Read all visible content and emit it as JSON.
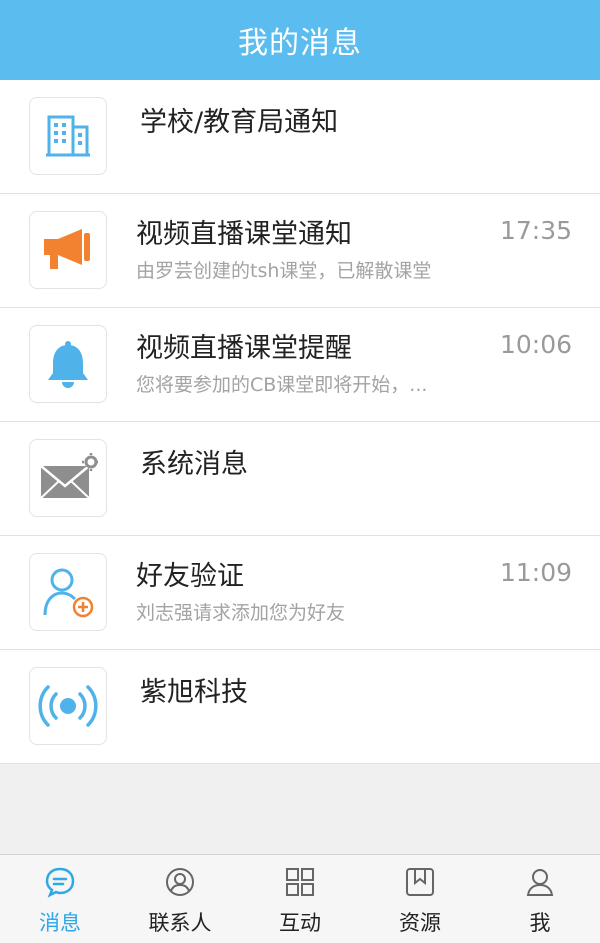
{
  "header": {
    "title": "我的消息"
  },
  "messages": [
    {
      "title": "学校/教育局通知",
      "subtitle": "",
      "time": "",
      "icon": "building-icon"
    },
    {
      "title": "视频直播课堂通知",
      "subtitle": "由罗芸创建的tsh课堂，已解散课堂",
      "time": "17:35",
      "icon": "megaphone-icon"
    },
    {
      "title": "视频直播课堂提醒",
      "subtitle": "您将要参加的CB课堂即将开始，...",
      "time": "10:06",
      "icon": "bell-icon"
    },
    {
      "title": "系统消息",
      "subtitle": "",
      "time": "",
      "icon": "mail-gear-icon"
    },
    {
      "title": "好友验证",
      "subtitle": "刘志强请求添加您为好友",
      "time": "11:09",
      "icon": "add-friend-icon"
    },
    {
      "title": "紫旭科技",
      "subtitle": "",
      "time": "",
      "icon": "broadcast-icon"
    }
  ],
  "tabs": [
    {
      "label": "消息",
      "icon": "chat-icon",
      "active": true
    },
    {
      "label": "联系人",
      "icon": "contact-icon",
      "active": false
    },
    {
      "label": "互动",
      "icon": "grid-icon",
      "active": false
    },
    {
      "label": "资源",
      "icon": "bookmark-icon",
      "active": false
    },
    {
      "label": "我",
      "icon": "user-icon",
      "active": false
    }
  ],
  "colors": {
    "header": "#5bbcf0",
    "accent": "#2ea8e6",
    "orange": "#f28130"
  }
}
